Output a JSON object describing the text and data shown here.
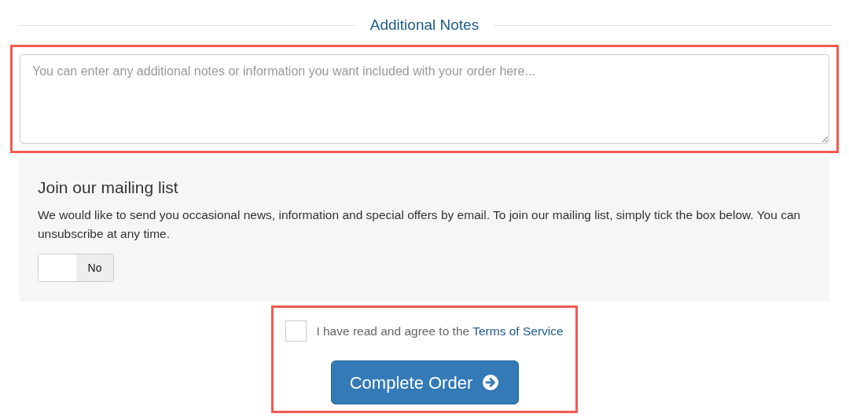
{
  "notes": {
    "heading": "Additional Notes",
    "placeholder": "You can enter any additional notes or information you want included with your order here..."
  },
  "mailing": {
    "title": "Join our mailing list",
    "text": "We would like to send you occasional news, information and special offers by email. To join our mailing list, simply tick the box below. You can unsubscribe at any time.",
    "toggle": {
      "label": "No",
      "on": false
    }
  },
  "terms": {
    "text": "I have read and agree to the",
    "link": "Terms of Service",
    "checked": false
  },
  "submit": {
    "label": "Complete Order"
  }
}
